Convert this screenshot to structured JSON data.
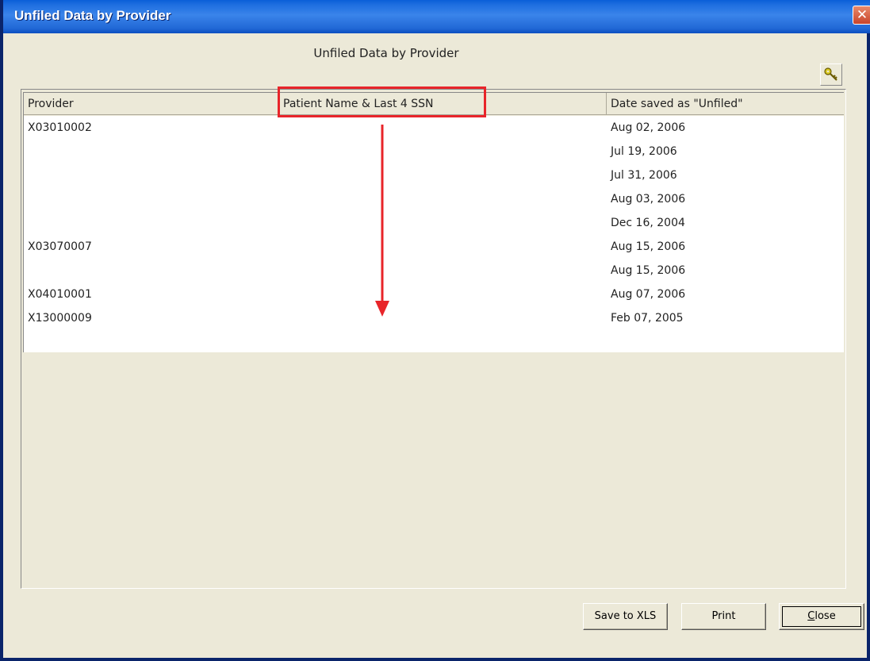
{
  "window": {
    "title": "Unfiled Data by Provider",
    "close_glyph": "✕"
  },
  "report": {
    "heading": "Unfiled Data by Provider"
  },
  "toolbar": {
    "key_icon": "key-icon"
  },
  "table": {
    "columns": [
      "Provider",
      "Patient Name & Last 4 SSN",
      "Date saved as \"Unfiled\""
    ],
    "rows": [
      {
        "provider": "X03010002",
        "date": "Aug 02, 2006"
      },
      {
        "provider": "",
        "date": "Jul 19, 2006"
      },
      {
        "provider": "",
        "date": "Jul 31, 2006"
      },
      {
        "provider": "",
        "date": "Aug 03, 2006"
      },
      {
        "provider": "",
        "date": "Dec 16, 2004"
      },
      {
        "provider": "X03070007",
        "date": "Aug 15, 2006"
      },
      {
        "provider": "",
        "date": "Aug 15, 2006"
      },
      {
        "provider": "X04010001",
        "date": "Aug 07, 2006"
      },
      {
        "provider": "X13000009",
        "date": "Feb 07, 2005"
      }
    ]
  },
  "annotation": {
    "highlight_color": "#e8252a"
  },
  "buttons": {
    "save": "Save to XLS",
    "print": "Print",
    "close_first": "C",
    "close_rest": "lose"
  }
}
